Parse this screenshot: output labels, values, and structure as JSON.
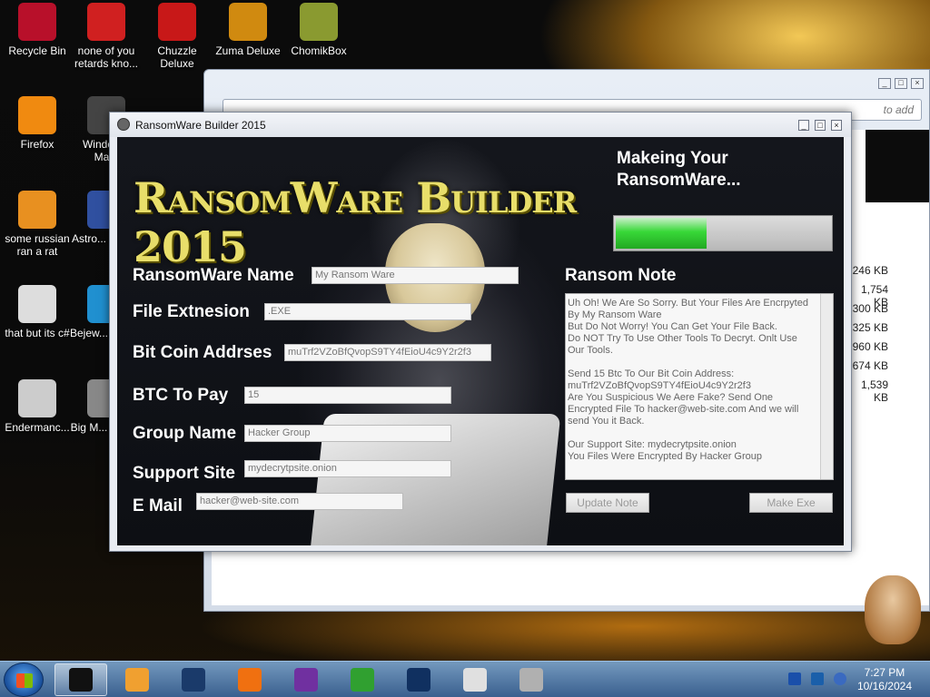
{
  "desktop": {
    "icons": [
      {
        "label": "Recycle Bin",
        "icon": "recycle-bin-icon",
        "color": "#b8102a"
      },
      {
        "label": "none of you retards kno...",
        "icon": "app-icon",
        "color": "#d02020"
      },
      {
        "label": "Chuzzle Deluxe",
        "icon": "chuzzle-icon",
        "color": "#c81818"
      },
      {
        "label": "Zuma Deluxe",
        "icon": "zuma-icon",
        "color": "#d08a10"
      },
      {
        "label": "ChomikBox",
        "icon": "chomikbox-icon",
        "color": "#8a9a30"
      },
      {
        "label": "Firefox",
        "icon": "firefox-icon",
        "color": "#f08a10"
      },
      {
        "label": "Window... Ma...",
        "icon": "windows-media-icon",
        "color": "#444444"
      },
      {
        "label": "some russian ran a rat",
        "icon": "file-icon",
        "color": "#e89020"
      },
      {
        "label": "Astro... Delu...",
        "icon": "game-icon",
        "color": "#3050a0"
      },
      {
        "label": "that but its c#",
        "icon": "shortcut-icon",
        "color": "#dddddd"
      },
      {
        "label": "Bejew... Delu...",
        "icon": "bejeweled-icon",
        "color": "#2090d0"
      },
      {
        "label": "Endermanc...",
        "icon": "window-icon",
        "color": "#cccccc"
      },
      {
        "label": "Big M... Delu...",
        "icon": "game-icon",
        "color": "#888888"
      }
    ]
  },
  "bg_window": {
    "address_text": "to add",
    "sizes": [
      "246 KB",
      "1,754 KB",
      "300 KB",
      "325 KB",
      "960 KB",
      "674 KB",
      "1,539 KB"
    ]
  },
  "app": {
    "title": "RansomWare Builder 2015",
    "brand": "RansomWare Builder 2015",
    "status": "Makeing Your RansomWare...",
    "progress_fraction": 0.42,
    "fields": {
      "name_label": "RansomWare Name",
      "name_value": "My Ransom Ware",
      "ext_label": "File Extnesion",
      "ext_value": ".EXE",
      "btc_label": "Bit Coin Addrses",
      "btc_value": "muTrf2VZoBfQvopS9TY4fEioU4c9Y2r2f3",
      "pay_label": "BTC To Pay",
      "pay_value": "15",
      "group_label": "Group Name",
      "group_value": "Hacker Group",
      "site_label": "Support Site",
      "site_value": "mydecrytpsite.onion",
      "email_label": "E Mail",
      "email_value": "hacker@web-site.com"
    },
    "note_label": "Ransom Note",
    "note_lines": [
      "Uh Oh! We Are So Sorry. But Your Files Are Encrpyted By My Ransom Ware",
      "But Do Not Worry! You Can Get Your File Back.",
      "Do NOT Try To Use Other Tools To Decryt. Onlt Use Our Tools.",
      "",
      "Send 15 Btc To Our Bit Coin Address: muTrf2VZoBfQvopS9TY4fEioU4c9Y2r2f3",
      "Are You Suspicious We Aere Fake? Send One Encrypted File To hacker@web-site.com And we will send You it Back.",
      "",
      "Our Support Site: mydecrytpsite.onion",
      "You Files Were Encrypted By Hacker Group"
    ],
    "update_button": "Update Note",
    "make_button": "Make Exe"
  },
  "taskbar": {
    "items": [
      {
        "icon": "black-box-icon",
        "color": "#111111",
        "active": true
      },
      {
        "icon": "media-player-icon",
        "color": "#f0a030",
        "active": false
      },
      {
        "icon": "globe-icon",
        "color": "#1a3a6a",
        "active": false
      },
      {
        "icon": "firefox-icon",
        "color": "#f07010",
        "active": false
      },
      {
        "icon": "visual-studio-icon",
        "color": "#7030a0",
        "active": false
      },
      {
        "icon": "windows-icon",
        "color": "#30a030",
        "active": false
      },
      {
        "icon": "monitor-icon",
        "color": "#103060",
        "active": false
      },
      {
        "icon": "java-icon",
        "color": "#e0e0e0",
        "active": false
      },
      {
        "icon": "skull-icon",
        "color": "#b0b0b0",
        "active": false
      }
    ],
    "time": "7:27 PM",
    "date": "10/16/2024"
  }
}
